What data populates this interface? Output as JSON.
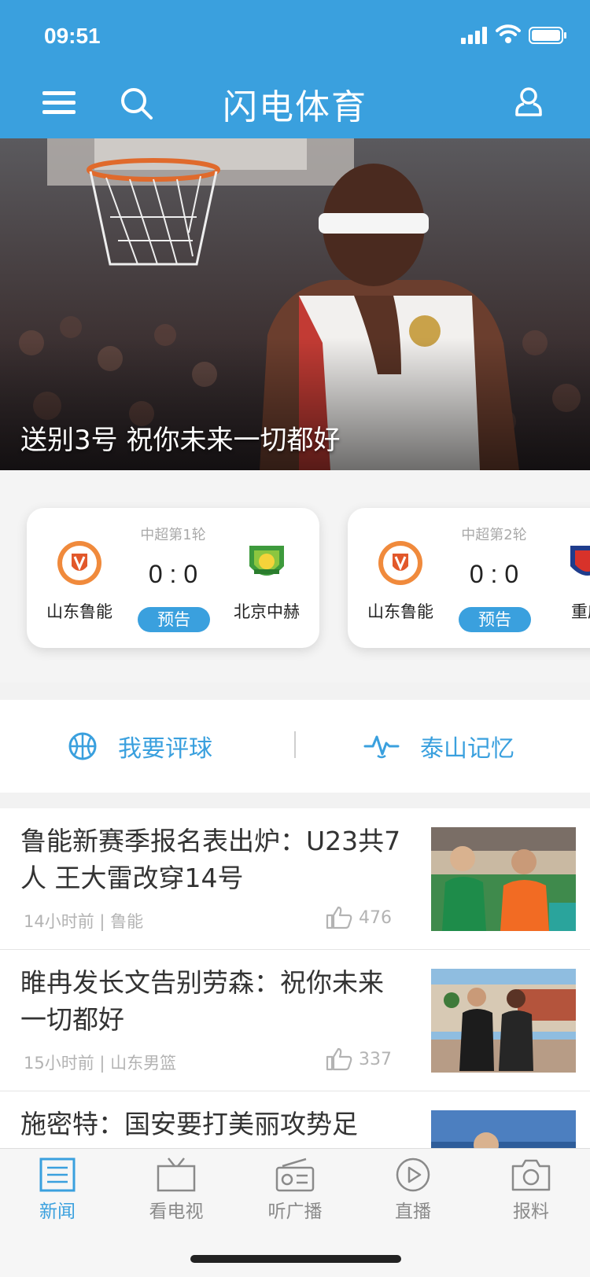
{
  "status_bar": {
    "time": "09:51"
  },
  "header": {
    "title": "闪电体育"
  },
  "hero": {
    "caption": "送别3号 祝你未来一切都好"
  },
  "matches": [
    {
      "round": "中超第1轮",
      "home": "山东鲁能",
      "away": "北京中赫",
      "score": "0 : 0",
      "status": "预告"
    },
    {
      "round": "中超第2轮",
      "home": "山东鲁能",
      "away": "重庆",
      "score": "0 : 0",
      "status": "预告"
    }
  ],
  "quick_links": [
    {
      "label": "我要评球",
      "icon": "basketball-icon"
    },
    {
      "label": "泰山记忆",
      "icon": "heartbeat-icon"
    }
  ],
  "news": [
    {
      "title": "鲁能新赛季报名表出炉：U23共7人 王大雷改穿14号",
      "time": "14小时前",
      "tag": "鲁能",
      "likes": "476"
    },
    {
      "title": "睢冉发长文告别劳森：祝你未来一切都好",
      "time": "15小时前",
      "tag": "山东男篮",
      "likes": "337"
    },
    {
      "title": "施密特：国安要打美丽攻势足",
      "time": "",
      "tag": "",
      "likes": ""
    }
  ],
  "tabs": [
    {
      "label": "新闻",
      "icon": "news-icon",
      "active": true
    },
    {
      "label": "看电视",
      "icon": "tv-icon",
      "active": false
    },
    {
      "label": "听广播",
      "icon": "radio-icon",
      "active": false
    },
    {
      "label": "直播",
      "icon": "play-icon",
      "active": false
    },
    {
      "label": "报料",
      "icon": "camera-icon",
      "active": false
    }
  ],
  "colors": {
    "brand": "#3aa0de",
    "text": "#333333",
    "muted": "#b3b3b3"
  }
}
